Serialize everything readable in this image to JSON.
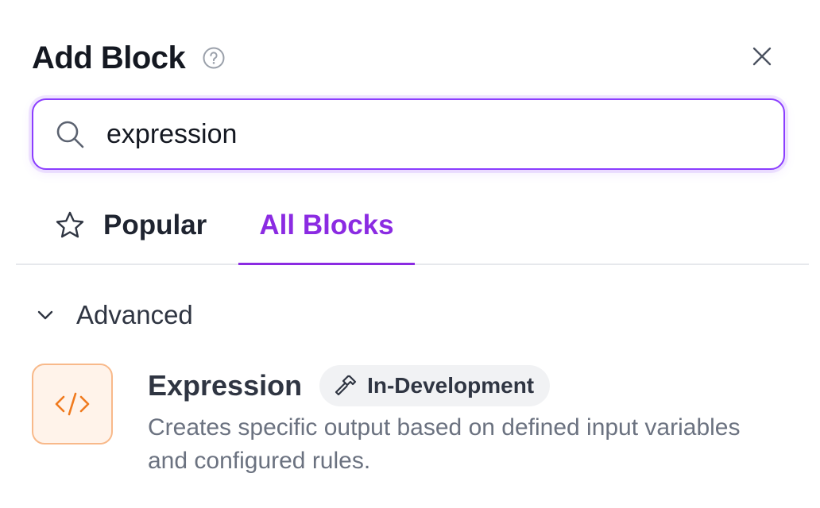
{
  "header": {
    "title": "Add Block",
    "help_icon": "question-circle-icon",
    "close_icon": "close-icon"
  },
  "search": {
    "value": "expression",
    "icon": "search-icon"
  },
  "tabs": [
    {
      "label": "Popular",
      "icon": "star-icon",
      "active": false
    },
    {
      "label": "All Blocks",
      "active": true
    }
  ],
  "section": {
    "label": "Advanced",
    "expanded": true,
    "icon": "chevron-down-icon"
  },
  "blocks": [
    {
      "title": "Expression",
      "icon": "code-icon",
      "badge": {
        "label": "In-Development",
        "icon": "hammer-icon"
      },
      "description": "Creates specific output based on defined input variables and configured rules."
    }
  ],
  "colors": {
    "accent": "#8b2be2",
    "search_border": "#8b3dff",
    "block_icon_border": "#f8b98a",
    "block_icon_bg": "#fff3ea",
    "block_icon_fg": "#f07a1e",
    "badge_bg": "#f1f2f4",
    "muted_text": "#6b7280"
  }
}
